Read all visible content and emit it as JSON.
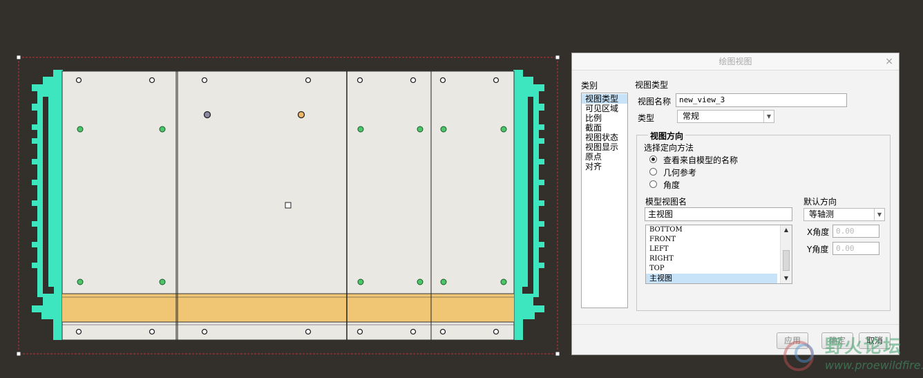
{
  "dialog": {
    "title": "绘图视图",
    "category_header": "类别",
    "categories": [
      {
        "label": "视图类型",
        "selected": true
      },
      {
        "label": "可见区域",
        "selected": false
      },
      {
        "label": "比例",
        "selected": false
      },
      {
        "label": "截面",
        "selected": false
      },
      {
        "label": "视图状态",
        "selected": false
      },
      {
        "label": "视图显示",
        "selected": false
      },
      {
        "label": "原点",
        "selected": false
      },
      {
        "label": "对齐",
        "selected": false
      }
    ],
    "section_title": "视图类型",
    "view_name_label": "视图名称",
    "view_name_value": "new_view_3",
    "type_label": "类型",
    "type_value": "常规",
    "orientation": {
      "group_title": "视图方向",
      "method_label": "选择定向方法",
      "options": [
        {
          "label": "查看来自模型的名称",
          "checked": true
        },
        {
          "label": "几何参考",
          "checked": false
        },
        {
          "label": "角度",
          "checked": false
        }
      ],
      "model_view_name_label": "模型视图名",
      "model_view_name_value": "主视图",
      "model_views": [
        {
          "label": "BOTTOM",
          "selected": false
        },
        {
          "label": "FRONT",
          "selected": false
        },
        {
          "label": "LEFT",
          "selected": false
        },
        {
          "label": "RIGHT",
          "selected": false
        },
        {
          "label": "TOP",
          "selected": false
        },
        {
          "label": "主视图",
          "selected": true
        }
      ],
      "default_orientation_label": "默认方向",
      "default_orientation_value": "等轴测",
      "x_angle_label": "X角度",
      "x_angle_value": "0.00",
      "y_angle_label": "Y角度",
      "y_angle_value": "0.00"
    },
    "buttons": {
      "apply": "应用",
      "ok": "确定",
      "cancel": "取消"
    }
  },
  "watermark": {
    "site_name": "野火论坛",
    "url": "www.proewildfire.cn"
  },
  "colors": {
    "background": "#33302c",
    "sheet": "#e9e8e2",
    "accent_band": "#f0c675",
    "rail": "#3ee6c0",
    "selection_dash": "#c0303a",
    "hole_green": "#4cc56a",
    "hole_orange": "#f0b66a"
  }
}
